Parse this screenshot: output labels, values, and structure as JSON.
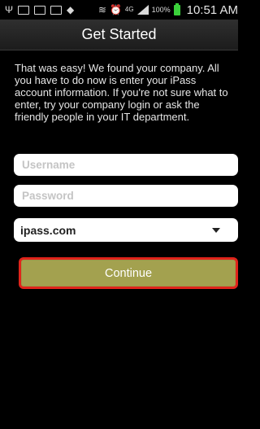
{
  "status_bar": {
    "icons": [
      "usb-icon",
      "image-icon",
      "voicemail-icon",
      "voicemail-icon",
      "wifi-icon",
      "vibrate-icon",
      "alarm-icon",
      "4g-data-icon",
      "signal-icon",
      "battery-icon"
    ],
    "network": "4G",
    "battery": "100%",
    "time": "10:51 AM",
    "battery_color": "#3bd13b"
  },
  "header": {
    "title": "Get Started"
  },
  "main": {
    "instructions": "That was easy! We found your company. All you have to do now is enter your iPass account information. If you're not sure what to enter, try your company login or ask the friendly people in your IT department.",
    "username": {
      "value": "",
      "placeholder": "Username"
    },
    "password": {
      "value": "",
      "placeholder": "Password"
    },
    "domain": {
      "selected": "ipass.com"
    },
    "continue_label": "Continue"
  },
  "colors": {
    "button_fill": "#a3a14f",
    "highlight_border": "#e0241b"
  }
}
